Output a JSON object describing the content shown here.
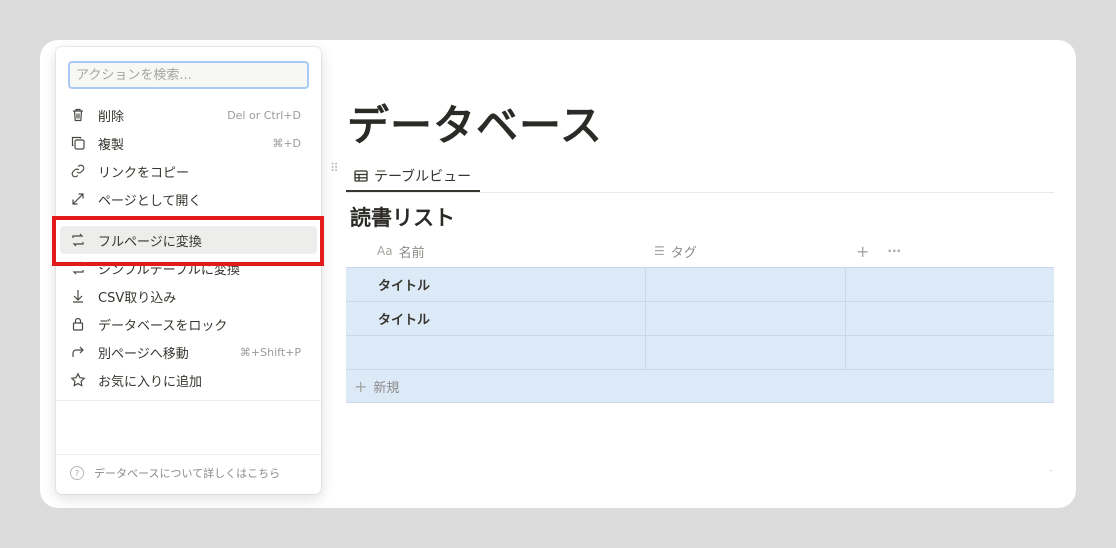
{
  "page": {
    "title": "データベース",
    "view_tab_label": "テーブルビュー",
    "table_title": "読書リスト",
    "columns": [
      {
        "name": "名前",
        "icon": "text-property-icon",
        "glyph": "Aa"
      },
      {
        "name": "タグ",
        "icon": "multi-select-property-icon",
        "glyph": "☰"
      }
    ],
    "add_column_glyph": "+",
    "more_glyph": "···",
    "rows": [
      {
        "name": "タイトル",
        "tag": ""
      },
      {
        "name": "タイトル",
        "tag": ""
      },
      {
        "name": "",
        "tag": ""
      }
    ],
    "new_row_label": "新規"
  },
  "menu": {
    "search_placeholder": "アクションを検索...",
    "items": [
      {
        "label": "削除",
        "shortcut": "Del or Ctrl+D",
        "icon": "trash-icon"
      },
      {
        "label": "複製",
        "shortcut": "⌘+D",
        "icon": "duplicate-icon"
      },
      {
        "label": "リンクをコピー",
        "shortcut": "",
        "icon": "link-icon"
      },
      {
        "label": "ページとして開く",
        "shortcut": "",
        "icon": "expand-icon"
      },
      {
        "label": "フルページに変換",
        "shortcut": "",
        "icon": "convert-icon",
        "highlighted": true
      },
      {
        "label": "シンプルテーブルに変換",
        "shortcut": "",
        "icon": "convert-table-icon"
      },
      {
        "label": "CSV取り込み",
        "shortcut": "",
        "icon": "download-icon"
      },
      {
        "label": "データベースをロック",
        "shortcut": "",
        "icon": "lock-icon"
      },
      {
        "label": "別ページへ移動",
        "shortcut": "⌘+Shift+P",
        "icon": "move-to-icon"
      },
      {
        "label": "お気に入りに追加",
        "shortcut": "",
        "icon": "star-icon"
      }
    ],
    "help_label": "データベースについて詳しくはこちら",
    "help_icon_glyph": "?"
  },
  "colors": {
    "background": "#dcdcdc",
    "selection_blue": "#dce9f7",
    "highlight_box": "#e31a1a",
    "search_focus": "#a9cbf3"
  }
}
